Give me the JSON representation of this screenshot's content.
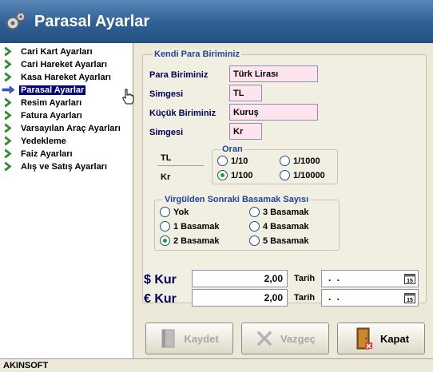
{
  "window": {
    "title": "Parasal Ayarlar"
  },
  "sidebar": {
    "items": [
      {
        "label": "Cari Kart Ayarları",
        "active": false
      },
      {
        "label": "Cari Hareket Ayarları",
        "active": false
      },
      {
        "label": "Kasa Hareket Ayarları",
        "active": false
      },
      {
        "label": "Parasal Ayarlar",
        "active": true
      },
      {
        "label": "Resim Ayarları",
        "active": false
      },
      {
        "label": "Fatura Ayarları",
        "active": false
      },
      {
        "label": "Varsayılan Araç Ayarları",
        "active": false
      },
      {
        "label": "Yedekleme",
        "active": false
      },
      {
        "label": "Faiz Ayarları",
        "active": false
      },
      {
        "label": "Alış ve Satış Ayarları",
        "active": false
      }
    ]
  },
  "currency": {
    "group_title": "Kendi Para Biriminiz",
    "unit_label": "Para Biriminiz",
    "unit_value": "Türk Lirası",
    "symbol_label": "Simgesi",
    "symbol_value": "TL",
    "subunit_label": "Küçük Biriminiz",
    "subunit_value": "Kuruş",
    "subsymbol_label": "Simgesi",
    "subsymbol_value": "Kr",
    "ratio_main": "TL",
    "ratio_sub": "Kr"
  },
  "oran": {
    "title": "Oran",
    "options": [
      "1/10",
      "1/100",
      "1/1000",
      "1/10000"
    ],
    "selected": "1/100"
  },
  "decimal": {
    "title": "Virgülden Sonraki Basamak Sayısı",
    "options": [
      "Yok",
      "1 Basamak",
      "2 Basamak",
      "3 Basamak",
      "4 Basamak",
      "5 Basamak"
    ],
    "selected": "2 Basamak"
  },
  "rates": {
    "usd_label": "$ Kur",
    "usd_value": "2,00",
    "eur_label": "€ Kur",
    "eur_value": "2,00",
    "date_label": "Tarih",
    "usd_date": " .  . ",
    "eur_date": " .  . "
  },
  "buttons": {
    "save": "Kaydet",
    "cancel": "Vazgeç",
    "close": "Kapat"
  },
  "status": {
    "text": "AKINSOFT"
  },
  "colors": {
    "accent": "#2f5f95",
    "selection": "#000080",
    "field_bg": "#fde4ef"
  }
}
